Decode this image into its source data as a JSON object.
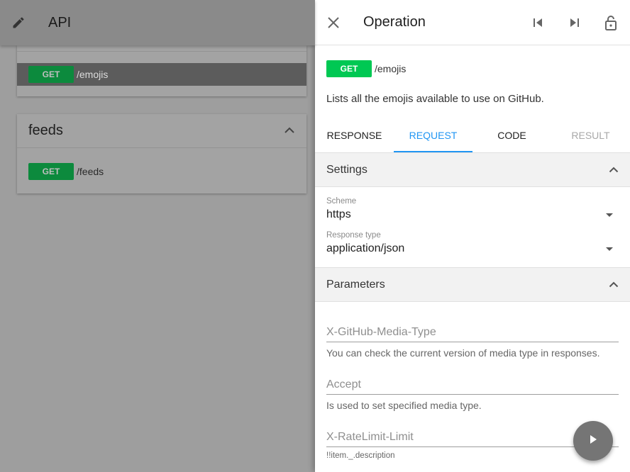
{
  "app": {
    "title": "API"
  },
  "groups": [
    {
      "operation": {
        "method": "GET",
        "path": "/emojis"
      }
    },
    {
      "name": "feeds",
      "operation": {
        "method": "GET",
        "path": "/feeds"
      }
    }
  ],
  "drawer": {
    "title": "Operation",
    "operation": {
      "method": "GET",
      "path": "/emojis",
      "description": "Lists all the emojis available to use on GitHub."
    },
    "tabs": [
      "RESPONSE",
      "REQUEST",
      "CODE",
      "RESULT"
    ],
    "active_tab": "REQUEST",
    "settings": {
      "label": "Settings",
      "scheme": {
        "label": "Scheme",
        "value": "https"
      },
      "response_type": {
        "label": "Response type",
        "value": "application/json"
      }
    },
    "parameters": {
      "label": "Parameters",
      "fields": [
        {
          "placeholder": "X-GitHub-Media-Type",
          "help": "You can check the current version of media type in responses."
        },
        {
          "placeholder": "Accept",
          "help": "Is used to set specified media type."
        },
        {
          "placeholder": "X-RateLimit-Limit",
          "help": "!!item._.description"
        }
      ]
    }
  },
  "colors": {
    "accent": "#2196f3",
    "get_badge": "#00c853",
    "fab": "#757575"
  }
}
